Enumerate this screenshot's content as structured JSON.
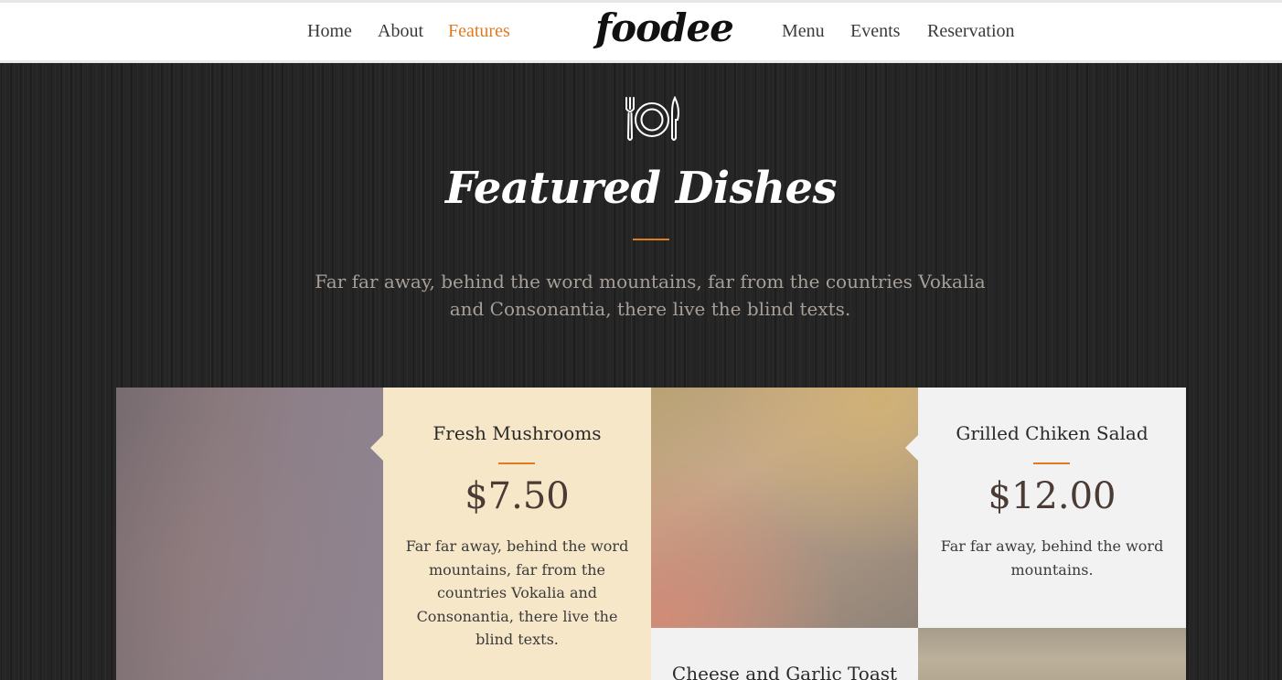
{
  "nav": {
    "left": [
      {
        "label": "Home"
      },
      {
        "label": "About"
      },
      {
        "label": "Features"
      }
    ],
    "logo": "foodee",
    "right": [
      {
        "label": "Menu"
      },
      {
        "label": "Events"
      },
      {
        "label": "Reservation"
      }
    ],
    "active": "Features"
  },
  "section": {
    "icon": "plate-fork-knife-icon",
    "title": "Featured Dishes",
    "subtitle": "Far far away, behind the word mountains, far from the countries Vokalia and Consonantia, there live the blind texts."
  },
  "dishes": [
    {
      "name": "Fresh Mushrooms",
      "price": "$7.50",
      "description": "Far far away, behind the word mountains, far from the countries Vokalia and Consonantia, there live the blind texts."
    },
    {
      "name": "Grilled Chiken Salad",
      "price": "$12.00",
      "description": "Far far away, behind the word mountains."
    },
    {
      "name": "Cheese and Garlic Toast"
    }
  ],
  "colors": {
    "accent": "#e07b22",
    "card_cream": "#f7e7c9",
    "card_grey": "#f2f2f2",
    "hero_bg": "#252525"
  }
}
